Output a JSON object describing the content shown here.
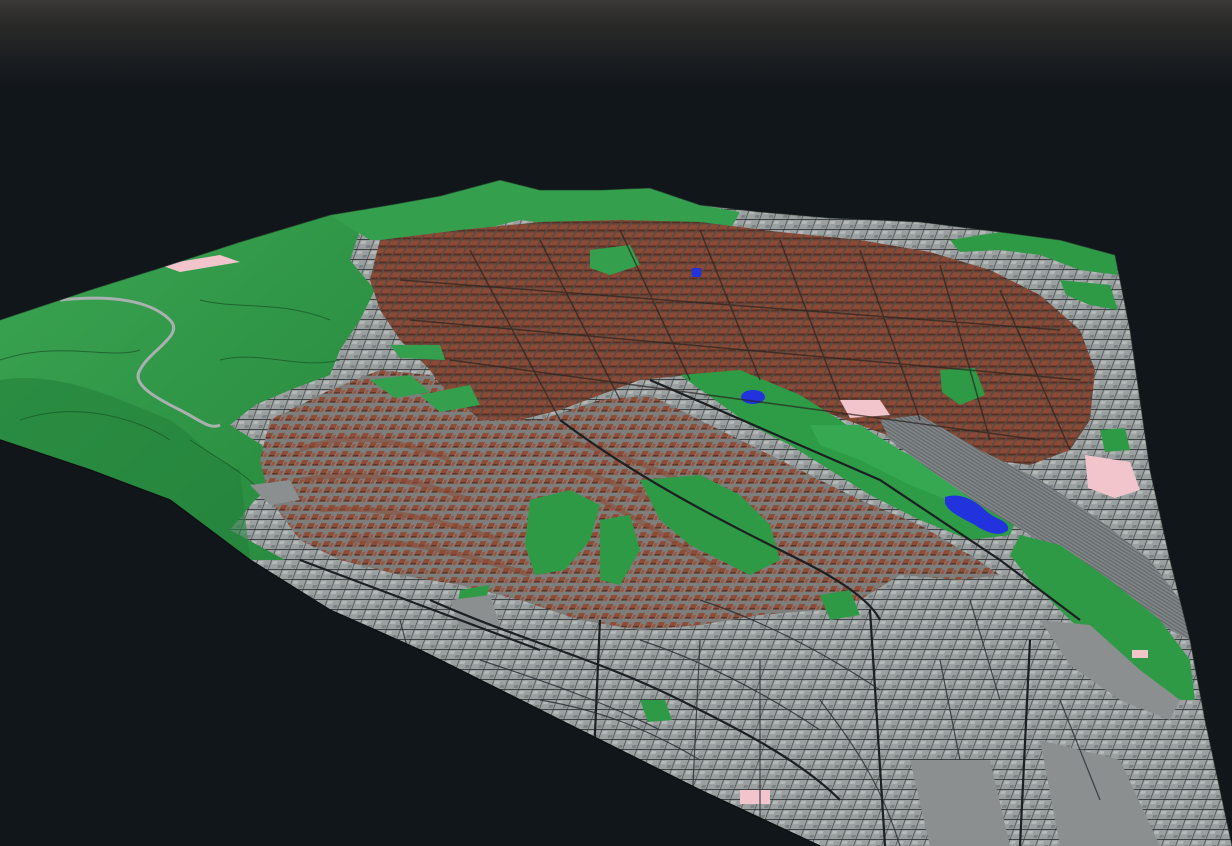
{
  "scene": {
    "type": "3d-city-terrain-view",
    "background_color": "#11161b",
    "colors": {
      "forest": "#2f9a45",
      "forest_shadow": "#1f7a35",
      "buildings": "#8a4a36",
      "buildings_dark": "#6e3a2a",
      "urban_base": "#9aa0a0",
      "urban_dark": "#6f7676",
      "water": "#2233dd",
      "rail": "#7d8285",
      "industrial_pink": "#f2c4cc",
      "roads": "#1c1f22"
    },
    "legend": []
  }
}
